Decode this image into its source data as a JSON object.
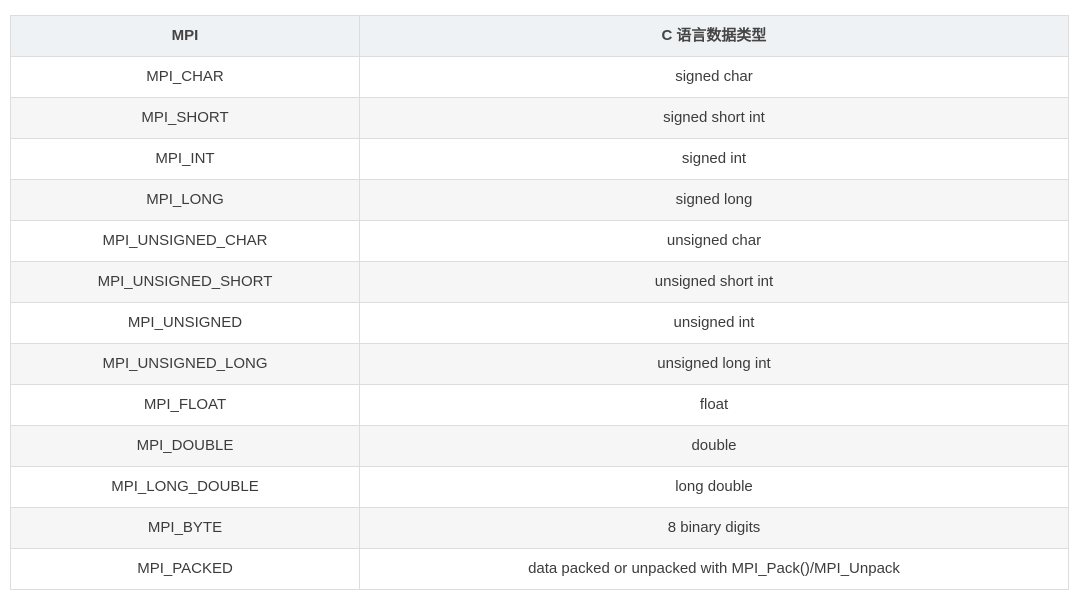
{
  "table": {
    "headers": [
      "MPI",
      "C 语言数据类型"
    ],
    "rows": [
      [
        "MPI_CHAR",
        "signed char"
      ],
      [
        "MPI_SHORT",
        "signed short int"
      ],
      [
        "MPI_INT",
        "signed int"
      ],
      [
        "MPI_LONG",
        "signed long"
      ],
      [
        "MPI_UNSIGNED_CHAR",
        "unsigned char"
      ],
      [
        "MPI_UNSIGNED_SHORT",
        "unsigned short int"
      ],
      [
        "MPI_UNSIGNED",
        "unsigned int"
      ],
      [
        "MPI_UNSIGNED_LONG",
        "unsigned long int"
      ],
      [
        "MPI_FLOAT",
        "float"
      ],
      [
        "MPI_DOUBLE",
        "double"
      ],
      [
        "MPI_LONG_DOUBLE",
        "long double"
      ],
      [
        "MPI_BYTE",
        "8 binary digits"
      ],
      [
        "MPI_PACKED",
        "data packed or unpacked with MPI_Pack()/MPI_Unpack"
      ]
    ]
  },
  "colors": {
    "header_background": "#eef2f5",
    "stripe_background": "#f6f6f6",
    "border": "#dddddd",
    "text": "#333333"
  }
}
